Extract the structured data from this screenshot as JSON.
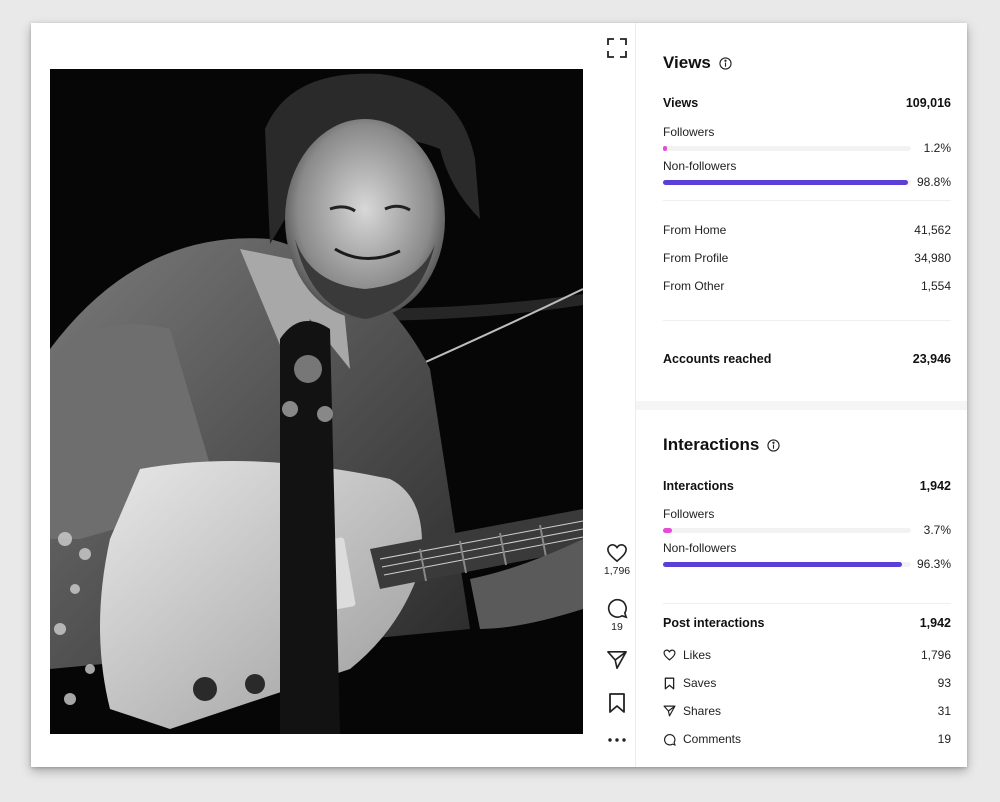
{
  "post": {
    "likes_count": "1,796",
    "comments_count": "19"
  },
  "views": {
    "title": "Views",
    "total_label": "Views",
    "total_value": "109,016",
    "followers_label": "Followers",
    "followers_pct": "1.2%",
    "followers_fraction": 0.012,
    "nonfollowers_label": "Non-followers",
    "nonfollowers_pct": "98.8%",
    "nonfollowers_fraction": 0.988,
    "sources": [
      {
        "label": "From Home",
        "value": "41,562"
      },
      {
        "label": "From Profile",
        "value": "34,980"
      },
      {
        "label": "From Other",
        "value": "1,554"
      }
    ],
    "reached_label": "Accounts reached",
    "reached_value": "23,946"
  },
  "interactions": {
    "title": "Interactions",
    "total_label": "Interactions",
    "total_value": "1,942",
    "followers_label": "Followers",
    "followers_pct": "3.7%",
    "followers_fraction": 0.037,
    "nonfollowers_label": "Non-followers",
    "nonfollowers_pct": "96.3%",
    "nonfollowers_fraction": 0.963,
    "post_label": "Post interactions",
    "post_value": "1,942",
    "breakdown": [
      {
        "label": "Likes",
        "value": "1,796",
        "icon": "heart-icon"
      },
      {
        "label": "Saves",
        "value": "93",
        "icon": "bookmark-icon"
      },
      {
        "label": "Shares",
        "value": "31",
        "icon": "send-icon"
      },
      {
        "label": "Comments",
        "value": "19",
        "icon": "comment-icon"
      }
    ]
  },
  "colors": {
    "followers_bar": "#e64ad6",
    "nonfollowers_bar": "#5b3fd6"
  }
}
